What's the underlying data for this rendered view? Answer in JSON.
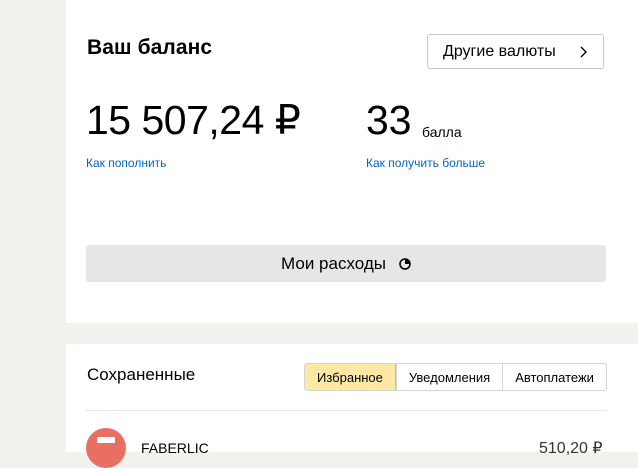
{
  "balance": {
    "title": "Ваш баланс",
    "other_currencies_label": "Другие валюты",
    "amount": "15 507,24 ₽",
    "topup_link": "Как пополнить",
    "points_value": "33",
    "points_unit": "балла",
    "points_link": "Как получить больше",
    "expenses_label": "Мои расходы"
  },
  "saved": {
    "title": "Сохраненные",
    "tabs": [
      {
        "label": "Избранное",
        "active": true
      },
      {
        "label": "Уведомления",
        "active": false
      },
      {
        "label": "Автоплатежи",
        "active": false
      }
    ],
    "items": [
      {
        "name": "FABERLIC",
        "amount": "510,20 ₽",
        "icon": "bank-card-icon"
      }
    ]
  },
  "colors": {
    "accent_link": "#0066cc",
    "active_tab": "#fde9a4",
    "avatar": "#ea6f63"
  }
}
